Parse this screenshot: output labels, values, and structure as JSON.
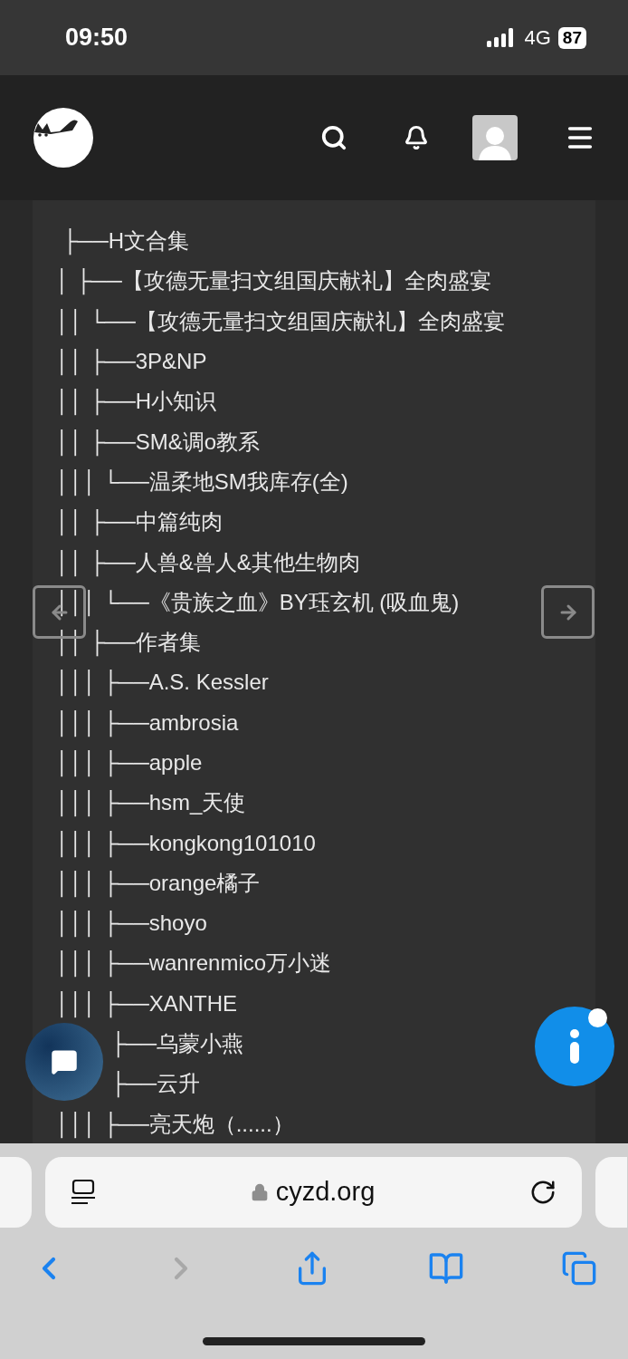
{
  "status_bar": {
    "time": "09:50",
    "network": "4G",
    "battery": "87"
  },
  "tree_lines": [
    {
      "text": " ├──H文合集"
    },
    {
      "text": "│ ├──【攻德无量扫文组国庆献礼】全肉盛宴"
    },
    {
      "text": "││ └──【攻德无量扫文组国庆献礼】全肉盛宴"
    },
    {
      "text": "││ ├──3P&NP"
    },
    {
      "text": "││ ├──H小知识"
    },
    {
      "text": "││ ├──SM&调o教系"
    },
    {
      "text": "│││ └──温柔地SM我库存(全)"
    },
    {
      "text": "││ ├──中篇纯肉"
    },
    {
      "text": "││ ├──人兽&兽人&其他生物肉"
    },
    {
      "text": "│││ └──《贵族之血》BY珏玄机 (吸血鬼)"
    },
    {
      "text": "││ ├──作者集"
    },
    {
      "text": "│││ ├──A.S. Kessler"
    },
    {
      "text": "│││ ├──ambrosia"
    },
    {
      "text": "│││ ├──apple"
    },
    {
      "text": "│││ ├──hsm_天使"
    },
    {
      "text": "│││ ├──kongkong101010"
    },
    {
      "text": "│││ ├──orange橘子"
    },
    {
      "text": "│││ ├──shoyo"
    },
    {
      "text": "│││ ├──wanrenmico万小迷"
    },
    {
      "text": "│││ ├──XANTHE"
    },
    {
      "kind": "covered",
      "text": "├──乌蒙小燕"
    },
    {
      "kind": "covered",
      "text": "├──云升"
    },
    {
      "text": "│││ ├──亮天炮（......）"
    }
  ],
  "browser": {
    "url": "cyzd.org"
  }
}
